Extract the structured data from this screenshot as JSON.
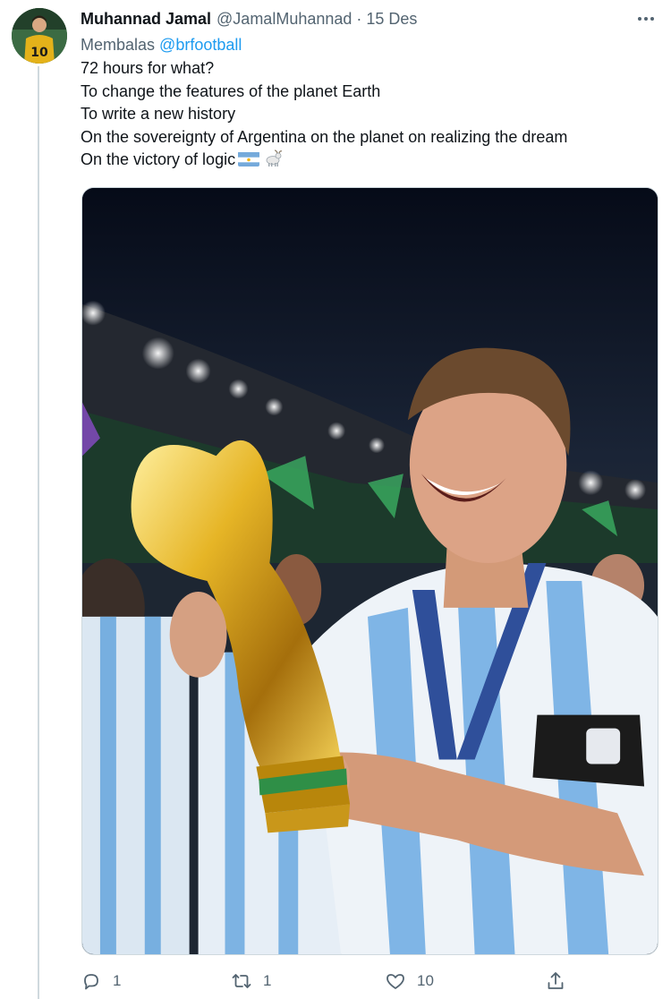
{
  "tweet": {
    "name": "Muhannad Jamal",
    "handle": "@JamalMuhannad",
    "separator": "·",
    "date": "15 Des",
    "reply_prefix": "Membalas",
    "reply_mention": "@brfootball",
    "lines": [
      "72 hours for what?",
      "To change the features of the planet Earth",
      "To write a new history",
      "On the sovereignty of Argentina on the planet on realizing the dream",
      "On the victory of logic"
    ]
  },
  "actions": {
    "replies": "1",
    "retweets": "1",
    "likes": "10"
  },
  "icons": [
    "more-options-icon",
    "argentina-flag-emoji",
    "goat-emoji",
    "reply-icon",
    "retweet-icon",
    "like-icon",
    "share-icon"
  ],
  "colors": {
    "link": "#1d9bf0",
    "secondary_text": "#536471",
    "thread_line": "#cfd9de"
  }
}
